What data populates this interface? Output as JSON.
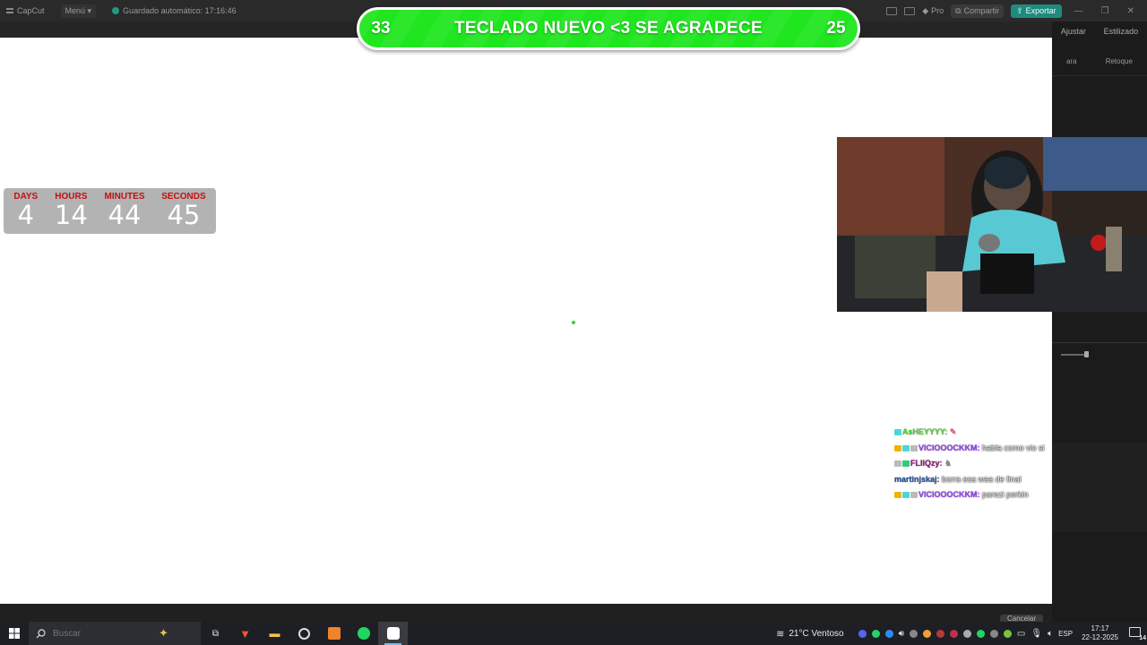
{
  "app_bar": {
    "logo": "CapCut",
    "menu": "Menú",
    "autosave": "Guardado automático: 17:16:46",
    "pro": "Pro",
    "share": "Compartir",
    "export": "Exportar"
  },
  "side_panel": {
    "tabs": [
      "Ajustar",
      "Estilizado"
    ],
    "subtabs": [
      "ara",
      "Retoque"
    ],
    "cancel": "Cancelar"
  },
  "goal": {
    "left_count": "33",
    "title": "TECLADO NUEVO <3 SE AGRADECE",
    "right_count": "25"
  },
  "countdown": [
    {
      "label": "DAYS",
      "value": "4"
    },
    {
      "label": "HOURS",
      "value": "14"
    },
    {
      "label": "MINUTES",
      "value": "44"
    },
    {
      "label": "SECONDS",
      "value": "45"
    }
  ],
  "chat": [
    {
      "user": "AsHEYYYY:",
      "user_color": "#55dd33",
      "text": "",
      "badges": [
        "#4bd7d7"
      ]
    },
    {
      "user": "VICIOOOCKKM:",
      "user_color": "#9a44ff",
      "text": "habla como vio si",
      "badges": [
        "#f0b400",
        "#4bd7d7",
        "#bbbbbb"
      ]
    },
    {
      "user": "FLIIQzy:",
      "user_color": "#a0168a",
      "text": "",
      "badges": [
        "#bbbbbb",
        "#33cc77"
      ]
    },
    {
      "user": "martinjskaj:",
      "user_color": "#2255aa",
      "text": "borra esa wea de final",
      "badges": []
    },
    {
      "user": "VICIOOOCKKM:",
      "user_color": "#9a44ff",
      "text": "parezi perkin",
      "badges": [
        "#f0b400",
        "#4bd7d7",
        "#bbbbbb"
      ]
    }
  ],
  "taskbar": {
    "search_placeholder": "Buscar",
    "weather": "21°C  Ventoso",
    "lang": "ESP",
    "time": "17:17",
    "date": "22-12-2025",
    "notifications": "14"
  },
  "colors": {
    "goal_green": "#1fe61f",
    "countdown_bg": "#b3b3b3",
    "countdown_label": "#c21010",
    "export_accent": "#1f8a7f"
  }
}
